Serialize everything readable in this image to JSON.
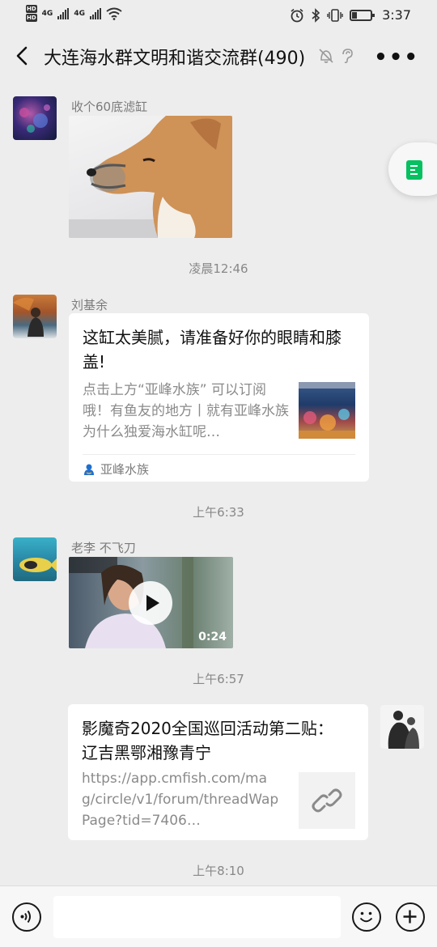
{
  "status_bar": {
    "hd_labels": [
      "HD",
      "HD"
    ],
    "net_labels": [
      "4G",
      "4G"
    ],
    "time": "3:37"
  },
  "header": {
    "title": "大连海水群文明和谐交流群(490)",
    "more": "•••"
  },
  "messages": [
    {
      "type": "image",
      "sender": "收个60底滤缸",
      "image_description": "shiba-dog-photo"
    },
    {
      "type": "time",
      "text": "凌晨12:46"
    },
    {
      "type": "link_card",
      "sender": "刘基余",
      "title": "这缸太美腻，请准备好你的眼睛和膝盖!",
      "desc": "点击上方“亚峰水族” 可以订阅哦！有鱼友的地方丨就有亚峰水族为什么独爱海水缸呢…",
      "source": "亚峰水族"
    },
    {
      "type": "time",
      "text": "上午6:33"
    },
    {
      "type": "video",
      "sender": "老李 不飞刀",
      "duration": "0:24"
    },
    {
      "type": "time",
      "text": "上午6:57"
    },
    {
      "type": "link_card_self",
      "title": "影魔奇2020全国巡回活动第二贴： 辽吉黑鄂湘豫青宁",
      "desc": "https://app.cmfish.com/mag/circle/v1/forum/threadWapPage?tid=7406…"
    },
    {
      "type": "time",
      "text": "上午8:10"
    }
  ],
  "input_bar": {
    "placeholder": ""
  },
  "colors": {
    "background": "#ededed",
    "accent": "#07c160"
  }
}
